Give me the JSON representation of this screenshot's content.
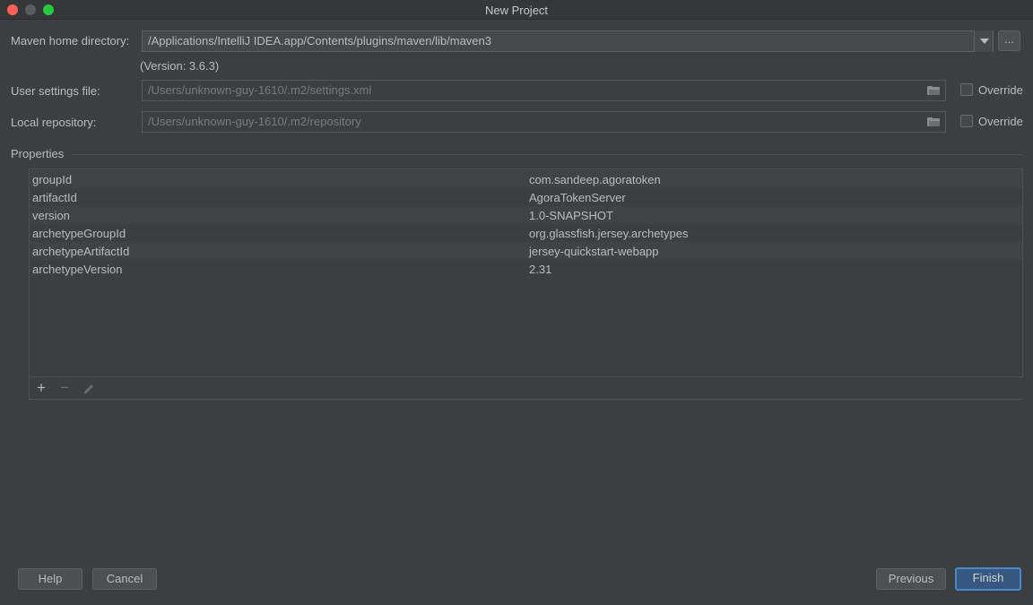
{
  "window": {
    "title": "New Project"
  },
  "maven_home": {
    "label": "Maven home directory:",
    "value": "/Applications/IntelliJ IDEA.app/Contents/plugins/maven/lib/maven3",
    "browse_label": "...",
    "version_text": "(Version: 3.6.3)"
  },
  "user_settings": {
    "label": "User settings file:",
    "value": "/Users/unknown-guy-1610/.m2/settings.xml",
    "override_label": "Override",
    "override_checked": false
  },
  "local_repo": {
    "label": "Local repository:",
    "value": "/Users/unknown-guy-1610/.m2/repository",
    "override_label": "Override",
    "override_checked": false
  },
  "properties": {
    "section_title": "Properties",
    "rows": [
      {
        "key": "groupId",
        "value": "com.sandeep.agoratoken"
      },
      {
        "key": "artifactId",
        "value": "AgoraTokenServer"
      },
      {
        "key": "version",
        "value": "1.0-SNAPSHOT"
      },
      {
        "key": "archetypeGroupId",
        "value": "org.glassfish.jersey.archetypes"
      },
      {
        "key": "archetypeArtifactId",
        "value": "jersey-quickstart-webapp"
      },
      {
        "key": "archetypeVersion",
        "value": "2.31"
      }
    ],
    "toolbar": {
      "add": "+",
      "remove": "−"
    }
  },
  "footer": {
    "help": "Help",
    "cancel": "Cancel",
    "previous": "Previous",
    "finish": "Finish"
  },
  "colors": {
    "accent": "#365880",
    "accent_border": "#4a88c7",
    "background": "#3c3f41"
  }
}
